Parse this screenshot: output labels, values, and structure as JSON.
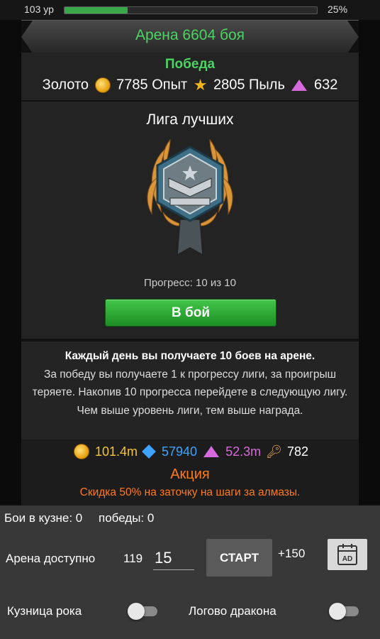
{
  "header": {
    "level": "103 ур",
    "xp_fraction": 0.25,
    "xp_percent": "25%"
  },
  "arena": {
    "title": "Арена 6604 боя",
    "result": "Победа",
    "rewards": {
      "gold_label": "Золото",
      "gold": "7785",
      "exp_label": "Опыт",
      "exp": "2805",
      "dust_label": "Пыль",
      "dust": "632"
    }
  },
  "league": {
    "name": "Лига лучших",
    "progress": "Прогресс: 10 из 10",
    "fight_button": "В бой"
  },
  "info": {
    "line_bold": "Каждый день вы получаете 10 боев на арене.",
    "text": "За победу вы получаете 1 к прогрессу лиги, за проигрыш теряете. Накопив 10 прогресса перейдете в следующую лигу. Чем выше уровень лиги, тем выше награда."
  },
  "currencies": {
    "gold": "101.4m",
    "diamonds": "57940",
    "dust": "52.3m",
    "keys": "782"
  },
  "promo": {
    "title": "Акция",
    "text": "Скидка 50% на заточку на шаги за алмазы."
  },
  "bottom": {
    "forge_fights": "Бои в кузне: 0",
    "wins": "победы: 0",
    "arena_label": "Арена доступно",
    "arena_available": "119",
    "arena_input": "15",
    "start_button": "СТАРТ",
    "bonus": "+150",
    "ad_icon_text": "AD",
    "toggle_forge": "Кузница рока",
    "toggle_dragon": "Логово дракона"
  },
  "colors": {
    "accent_green": "#4cd463",
    "promo_orange": "#ff7a1a",
    "diamond_blue": "#3ea3ff",
    "dust_pink": "#d66ad8"
  },
  "icons": [
    "coin-icon",
    "star-icon",
    "dust-gem-icon",
    "diamond-icon",
    "key-icon",
    "ad-icon",
    "league-badge-icon"
  ]
}
